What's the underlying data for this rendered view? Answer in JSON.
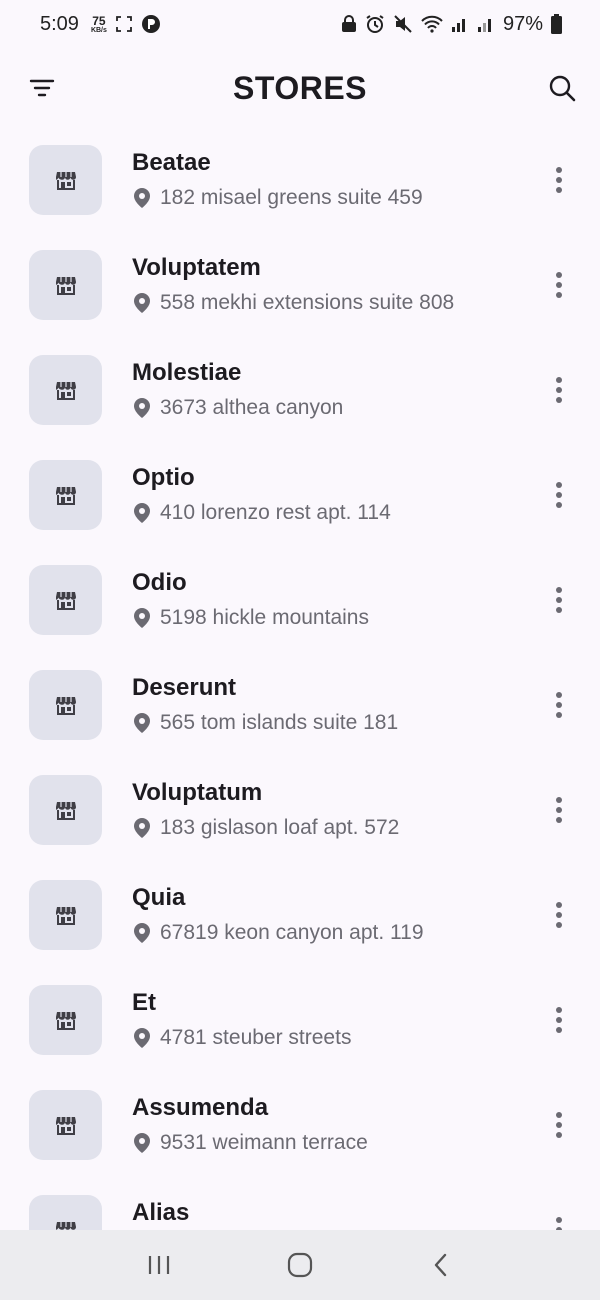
{
  "status_bar": {
    "time": "5:09",
    "data_speed_value": "75",
    "data_speed_unit": "KB/s",
    "battery": "97%"
  },
  "app_bar": {
    "title": "STORES",
    "filter_icon": "filter-icon",
    "search_icon": "search-icon"
  },
  "stores": [
    {
      "name": "Beatae",
      "address": "182 misael greens suite 459"
    },
    {
      "name": "Voluptatem",
      "address": "558 mekhi extensions suite 808"
    },
    {
      "name": "Molestiae",
      "address": "3673 althea canyon"
    },
    {
      "name": "Optio",
      "address": "410 lorenzo rest apt. 114"
    },
    {
      "name": "Odio",
      "address": "5198 hickle mountains"
    },
    {
      "name": "Deserunt",
      "address": "565 tom islands suite 181"
    },
    {
      "name": "Voluptatum",
      "address": "183 gislason loaf apt. 572"
    },
    {
      "name": "Quia",
      "address": "67819 keon canyon apt. 119"
    },
    {
      "name": "Et",
      "address": "4781 steuber streets"
    },
    {
      "name": "Assumenda",
      "address": "9531 weimann terrace"
    },
    {
      "name": "Alias",
      "address": ""
    }
  ],
  "icons": {
    "store": "store-icon",
    "location": "location-pin-icon",
    "more": "more-vert-icon"
  },
  "colors": {
    "background": "#fbf8fd",
    "avatar_bg": "#e1e2ec",
    "secondary_text": "#6b6a72",
    "nav_bar": "#ececef"
  }
}
